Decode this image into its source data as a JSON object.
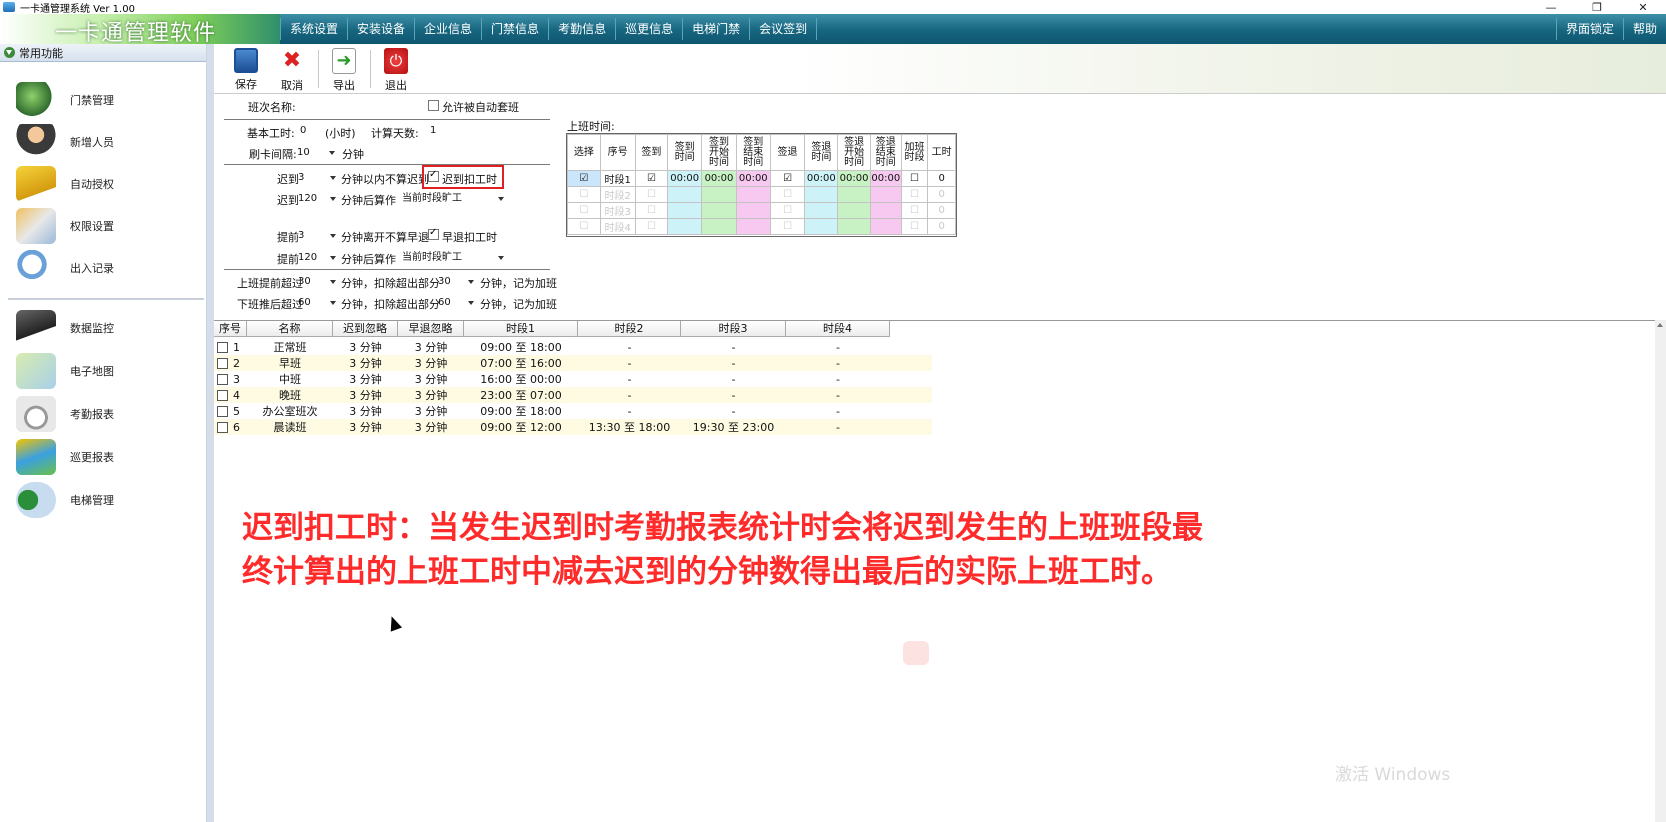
{
  "window": {
    "title": "一卡通管理系统  Ver 1.00",
    "minimize": "—",
    "restore": "❐",
    "close": "✕"
  },
  "app": {
    "logo_text": "一卡通管理软件"
  },
  "menubar": {
    "items": [
      "系统设置",
      "安装设备",
      "企业信息",
      "门禁信息",
      "考勤信息",
      "巡更信息",
      "电梯门禁",
      "会议签到"
    ],
    "right_items": [
      "界面锁定",
      "帮助"
    ]
  },
  "sidebar": {
    "header": "常用功能",
    "items": [
      "门禁管理",
      "新增人员",
      "自动授权",
      "权限设置",
      "出入记录",
      "数据监控",
      "电子地图",
      "考勤报表",
      "巡更报表",
      "电梯管理"
    ]
  },
  "toolbar": {
    "save": "保存",
    "cancel": "取消",
    "export": "导出",
    "exit": "退出"
  },
  "form": {
    "shift_name_label": "班次名称:",
    "shift_name_value": "",
    "allow_auto_label": "允许被自动套班",
    "base_hours_label": "基本工时:",
    "base_hours_value": "0",
    "hours_unit": "(小时)",
    "calc_days_label": "计算天数:",
    "calc_days_value": "1",
    "card_interval_label": "刷卡间隔:",
    "card_interval_value": "10",
    "minute": "分钟",
    "late_label": "迟到",
    "late_value": "3",
    "late_ignore_text": "分钟以内不算迟到",
    "late_deduct_label": "迟到扣工时",
    "late2_label": "迟到",
    "late2_value": "120",
    "after_text": "分钟后算作",
    "late2_action": "当前时段旷工",
    "early_label": "提前",
    "early_value": "3",
    "early_ignore_text": "分钟离开不算早退",
    "early_deduct_label": "早退扣工时",
    "early2_label": "提前",
    "early2_value": "120",
    "early2_action": "当前时段旷工",
    "ot_before_label": "上班提前超过",
    "ot_before_value": "30",
    "ot_after_label": "下班推后超过",
    "ot_after_value": "60",
    "ot_deduct_text": "分钟，扣除超出部分",
    "ot_before_deduct": "30",
    "ot_after_deduct": "60",
    "ot_suffix": "分钟，记为加班"
  },
  "onduty": {
    "title": "上班时间:",
    "headers": [
      "选择",
      "序号",
      "签到",
      "签到时间",
      "签到开始时间",
      "签到结束时间",
      "签退",
      "签退时间",
      "签退开始时间",
      "签退结束时间",
      "加班时段",
      "工时"
    ],
    "header_display": [
      "选择",
      "序号",
      "签到",
      "签到\n时间",
      "签到\n开始\n时间",
      "签到\n结束\n时间",
      "签退",
      "签退\n时间",
      "签退\n开始\n时间",
      "签退\n结束\n时间",
      "加班\n时段",
      "工时"
    ],
    "rows": [
      {
        "seq": "时段1",
        "t1": "00:00",
        "t2": "00:00",
        "t3": "00:00",
        "t4": "00:00",
        "t5": "00:00",
        "t6": "00:00",
        "hours": "0",
        "selected": true
      },
      {
        "seq": "时段2",
        "hours": "0"
      },
      {
        "seq": "时段3",
        "hours": "0"
      },
      {
        "seq": "时段4",
        "hours": "0"
      }
    ]
  },
  "shift_list": {
    "headers": [
      "序号",
      "名称",
      "迟到忽略",
      "早退忽略",
      "时段1",
      "时段2",
      "时段3",
      "时段4"
    ],
    "rows": [
      {
        "no": "1",
        "name": "正常班",
        "late": "3 分钟",
        "early": "3 分钟",
        "p1": "09:00 至 18:00",
        "p2": "-",
        "p3": "-",
        "p4": "-"
      },
      {
        "no": "2",
        "name": "早班",
        "late": "3 分钟",
        "early": "3 分钟",
        "p1": "07:00 至 16:00",
        "p2": "-",
        "p3": "-",
        "p4": "-"
      },
      {
        "no": "3",
        "name": "中班",
        "late": "3 分钟",
        "early": "3 分钟",
        "p1": "16:00 至 00:00",
        "p2": "-",
        "p3": "-",
        "p4": "-"
      },
      {
        "no": "4",
        "name": "晚班",
        "late": "3 分钟",
        "early": "3 分钟",
        "p1": "23:00 至 07:00",
        "p2": "-",
        "p3": "-",
        "p4": "-"
      },
      {
        "no": "5",
        "name": "办公室班次",
        "late": "3 分钟",
        "early": "3 分钟",
        "p1": "09:00 至 18:00",
        "p2": "-",
        "p3": "-",
        "p4": "-"
      },
      {
        "no": "6",
        "name": "晨读班",
        "late": "3 分钟",
        "early": "3 分钟",
        "p1": "09:00 至 12:00",
        "p2": "13:30 至 18:00",
        "p3": "19:30 至 23:00",
        "p4": "-"
      }
    ]
  },
  "caption": {
    "line1": "迟到扣工时：当发生迟到时考勤报表统计时会将迟到发生的上班班段最",
    "line2": "终计算出的上班工时中减去迟到的分钟数得出最后的实际上班工时。"
  },
  "watermark": "激活 Windows",
  "colors": {
    "menubar": "#16657f",
    "caption": "#ff2a2a",
    "highlight_box": "#e02020",
    "col_cyan": "#cdf3f8",
    "col_green": "#c8f2c3",
    "col_pink": "#f7c9f0",
    "row_alt": "#fffbe3"
  }
}
